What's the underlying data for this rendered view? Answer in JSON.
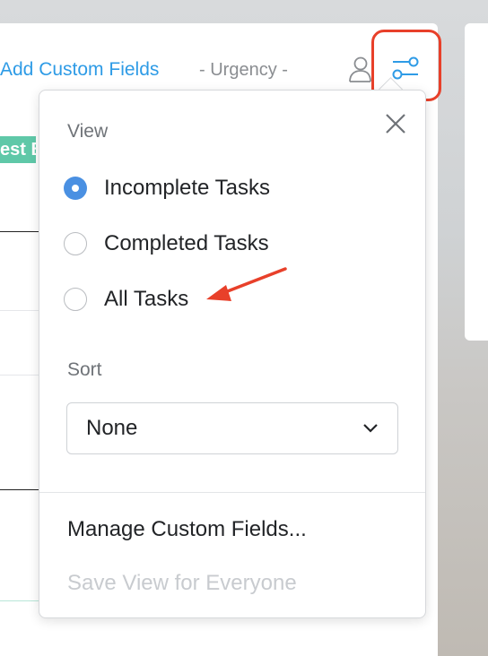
{
  "toolbar": {
    "add_custom_fields": "Add Custom Fields",
    "urgency": "- Urgency -",
    "person_icon": "person-icon",
    "filter_icon": "sliders-icon"
  },
  "background": {
    "tag_text": "est B"
  },
  "filter_menu": {
    "view_heading": "View",
    "view_options": [
      {
        "label": "Incomplete Tasks",
        "selected": true
      },
      {
        "label": "Completed Tasks",
        "selected": false
      },
      {
        "label": "All Tasks",
        "selected": false
      }
    ],
    "sort_heading": "Sort",
    "sort_value": "None",
    "manage_custom_fields": "Manage Custom Fields...",
    "save_view": "Save View for Everyone",
    "close_icon": "close-icon"
  },
  "colors": {
    "accent_blue": "#2e9be6",
    "radio_selected": "#4a90e2",
    "highlight_red": "#e8402a",
    "tag_green": "#5fc8a8",
    "disabled_text": "#c8cbcf"
  }
}
